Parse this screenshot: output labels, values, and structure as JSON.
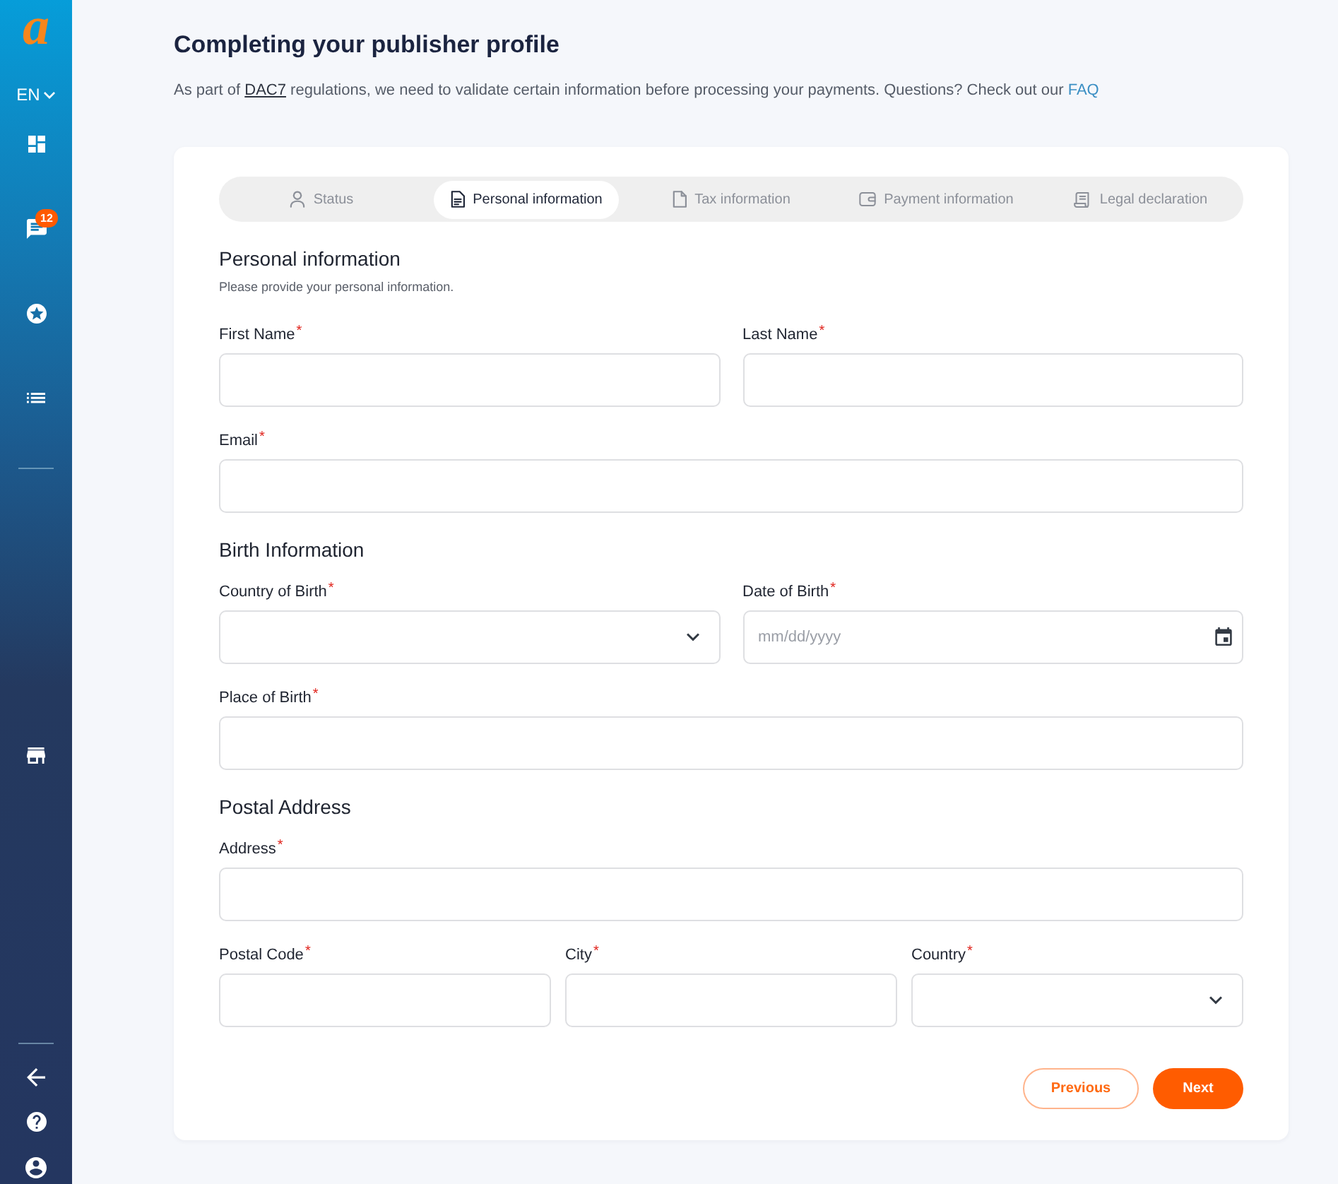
{
  "sidebar": {
    "logo": "a",
    "language": "EN",
    "nav": [
      {
        "kind": "dashboard"
      },
      {
        "kind": "messages",
        "badge": "12"
      },
      {
        "kind": "star"
      },
      {
        "kind": "list"
      }
    ],
    "extra": [
      {
        "kind": "store"
      }
    ],
    "footer": [
      {
        "kind": "back"
      },
      {
        "kind": "help"
      },
      {
        "kind": "account"
      }
    ]
  },
  "page": {
    "title": "Completing your publisher profile",
    "intro": [
      {
        "kind": "text",
        "text": "As part of "
      },
      {
        "kind": "term",
        "text": "DAC7"
      },
      {
        "kind": "text",
        "text": " regulations, we need to validate certain information before processing your payments. Questions? Check out our "
      },
      {
        "kind": "link",
        "text": "FAQ"
      }
    ]
  },
  "steps": [
    {
      "label": "Status",
      "kind": "person",
      "selected": false
    },
    {
      "label": "Personal information",
      "kind": "document",
      "selected": true
    },
    {
      "label": "Tax information",
      "kind": "file",
      "selected": false
    },
    {
      "label": "Payment information",
      "kind": "wallet",
      "selected": false
    },
    {
      "label": "Legal declaration",
      "kind": "scroll",
      "selected": false
    }
  ],
  "sections": [
    {
      "title": "Personal information",
      "description": "Please provide your personal information.",
      "rows": [
        [
          {
            "label": "First Name$^{*}$",
            "kind": "text"
          },
          {
            "label": "Last Name$^{*}$",
            "kind": "text"
          }
        ],
        [
          {
            "label": "Email$^{*}$",
            "kind": "text"
          }
        ]
      ]
    },
    {
      "title": "Birth Information",
      "rows": [
        [
          {
            "label": "Country of Birth$^{*}$",
            "kind": "select"
          },
          {
            "label": "Date of Birth$^{*}$",
            "kind": "date",
            "placeholder": "mm/dd/yyyy"
          }
        ],
        [
          {
            "label": "Place of Birth$^{*}$",
            "kind": "text"
          }
        ]
      ]
    },
    {
      "title": "Postal Address",
      "rows": [
        [
          {
            "label": "Address$^{*}$",
            "kind": "text"
          }
        ],
        [
          {
            "label": "Postal Code$^{*}$",
            "kind": "text"
          },
          {
            "label": "City$^{*}$",
            "kind": "text"
          },
          {
            "label": "Country$^{*}$",
            "kind": "select"
          }
        ]
      ]
    }
  ],
  "buttons": [
    {
      "label": "Previous",
      "kind": "previous"
    },
    {
      "label": "Next",
      "kind": "next"
    }
  ]
}
